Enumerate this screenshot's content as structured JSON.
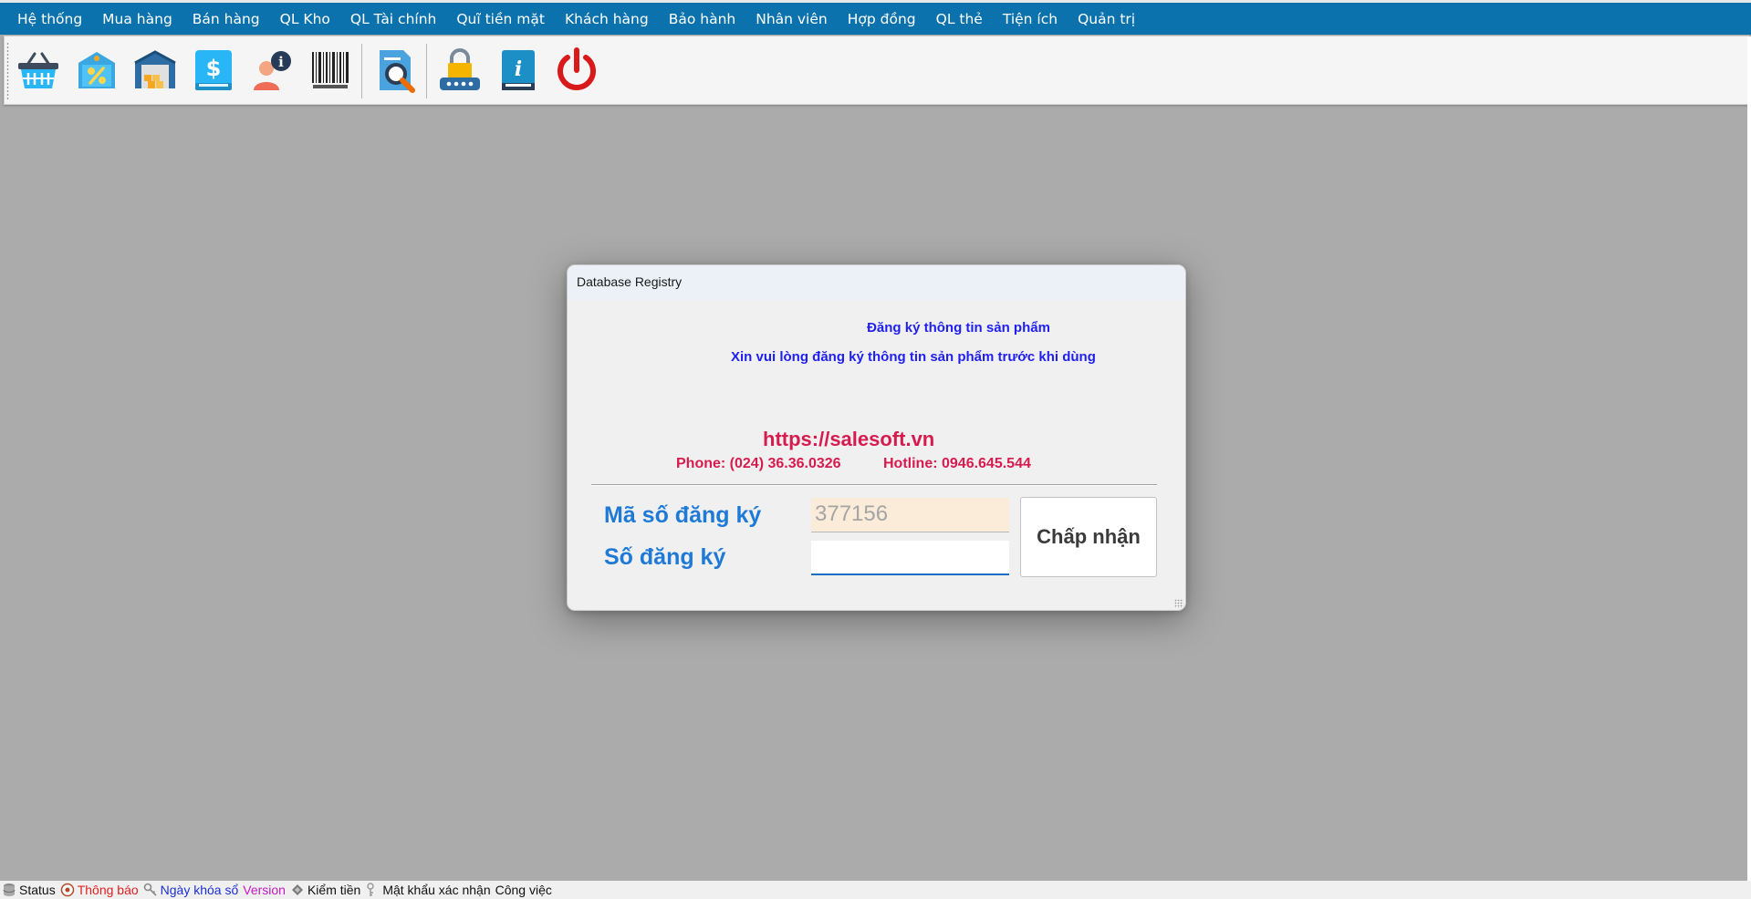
{
  "menu": {
    "items": [
      "Hệ thống",
      "Mua hàng",
      "Bán hàng",
      "QL Kho",
      "QL Tài chính",
      "Quĩ tiền mặt",
      "Khách hàng",
      "Bảo hành",
      "Nhân viên",
      "Hợp đồng",
      "QL thẻ",
      "Tiện ích",
      "Quản trị"
    ]
  },
  "toolbar": {
    "icons": [
      "shopping-basket-icon",
      "discount-tag-icon",
      "warehouse-icon",
      "finance-book-icon",
      "employee-info-icon",
      "barcode-icon",
      "search-document-icon",
      "password-lock-icon",
      "info-book-icon",
      "power-icon"
    ]
  },
  "dialog": {
    "title": "Database Registry",
    "heading": "Đăng ký thông tin sản phẩm",
    "subheading": "Xin vui lòng đăng ký thông tin sản phẩm trước khi dùng",
    "website": "https://salesoft.vn",
    "phone": "Phone: (024) 36.36.0326",
    "hotline": "Hotline: 0946.645.544",
    "code_label": "Mã số đăng ký",
    "code_value": "377156",
    "reg_label": "Số đăng ký",
    "reg_value": "",
    "accept_label": "Chấp nhận"
  },
  "statusbar": {
    "status": "Status",
    "notice": "Thông báo",
    "lock_date": "Ngày khóa sổ",
    "version": "Version",
    "cash_check": "Kiểm tiền",
    "confirm_password": "Mật khẩu xác nhận",
    "tasks": "Công việc"
  },
  "colors": {
    "menubar": "#0b72ad",
    "desktop": "#ababab",
    "heading": "#1f1ff2",
    "contact": "#d61c4e",
    "label": "#1e7ad6",
    "code_bg": "#fbebd9"
  }
}
